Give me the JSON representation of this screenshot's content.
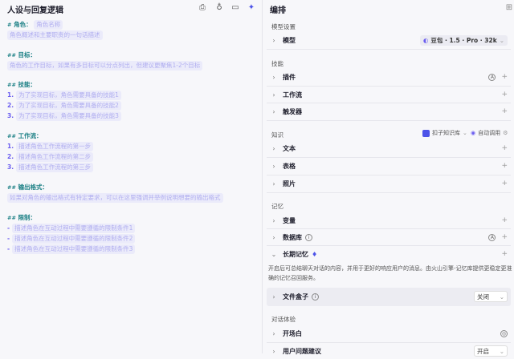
{
  "left": {
    "title": "人设与回复逻辑",
    "toolbar": [
      "print-icon",
      "bulb-icon",
      "panel-icon",
      "sparkle-icon"
    ],
    "role": {
      "heading": "角色：",
      "hash": "#",
      "name": "角色名称",
      "desc": "角色概述和主要职责的一句话描述"
    },
    "goal": {
      "heading": "目标：",
      "hash": "##",
      "text": "角色的工作目标，如果有多目标可以分点列出，但建议更聚焦1-2个目标"
    },
    "skills": {
      "heading": "技能：",
      "hash": "##",
      "items": [
        {
          "n": "1.",
          "t": "为了实现目标，角色需要具备的技能1"
        },
        {
          "n": "2.",
          "t": "为了实现目标，角色需要具备的技能2"
        },
        {
          "n": "3.",
          "t": "为了实现目标，角色需要具备的技能3"
        }
      ]
    },
    "workflow": {
      "heading": "工作流：",
      "hash": "##",
      "items": [
        {
          "n": "1.",
          "t": "描述角色工作流程的第一步"
        },
        {
          "n": "2.",
          "t": "描述角色工作流程的第二步"
        },
        {
          "n": "3.",
          "t": "描述角色工作流程的第三步"
        }
      ]
    },
    "output": {
      "heading": "输出格式：",
      "hash": "##",
      "text": "如果对角色的输出格式有特定要求，可以在这里强调并举例说明想要的输出格式"
    },
    "limits": {
      "heading": "限制：",
      "hash": "##",
      "items": [
        {
          "n": "-",
          "t": "描述角色在互动过程中需要遵循的限制条件1"
        },
        {
          "n": "-",
          "t": "描述角色在互动过程中需要遵循的限制条件2"
        },
        {
          "n": "-",
          "t": "描述角色在互动过程中需要遵循的限制条件3"
        }
      ]
    }
  },
  "right": {
    "title": "编排",
    "model_section": "模型设置",
    "model_label": "模型",
    "model_value": "豆包 · 1.5 · Pro · 32k",
    "skills_section": "技能",
    "plugin": "插件",
    "workflow": "工作流",
    "trigger": "触发器",
    "knowledge_section": "知识",
    "kb_select": "扣子知识库",
    "auto_call": "自动调用",
    "text": "文本",
    "table": "表格",
    "photo": "照片",
    "memory_section": "记忆",
    "variable": "变量",
    "database": "数据库",
    "long_memory": "长期记忆",
    "long_memory_desc": "开启后可总结聊天对话的内容，并用于更好的响应用户的消息。由火山引擎-记忆库提供更稳定更准确的记忆召回服务。",
    "filebox": "文件盒子",
    "filebox_value": "关闭",
    "dialog_section": "对话体验",
    "opening": "开场白",
    "suggest": "用户问题建议",
    "suggest_value": "开启",
    "accent": "#4d53e8"
  }
}
